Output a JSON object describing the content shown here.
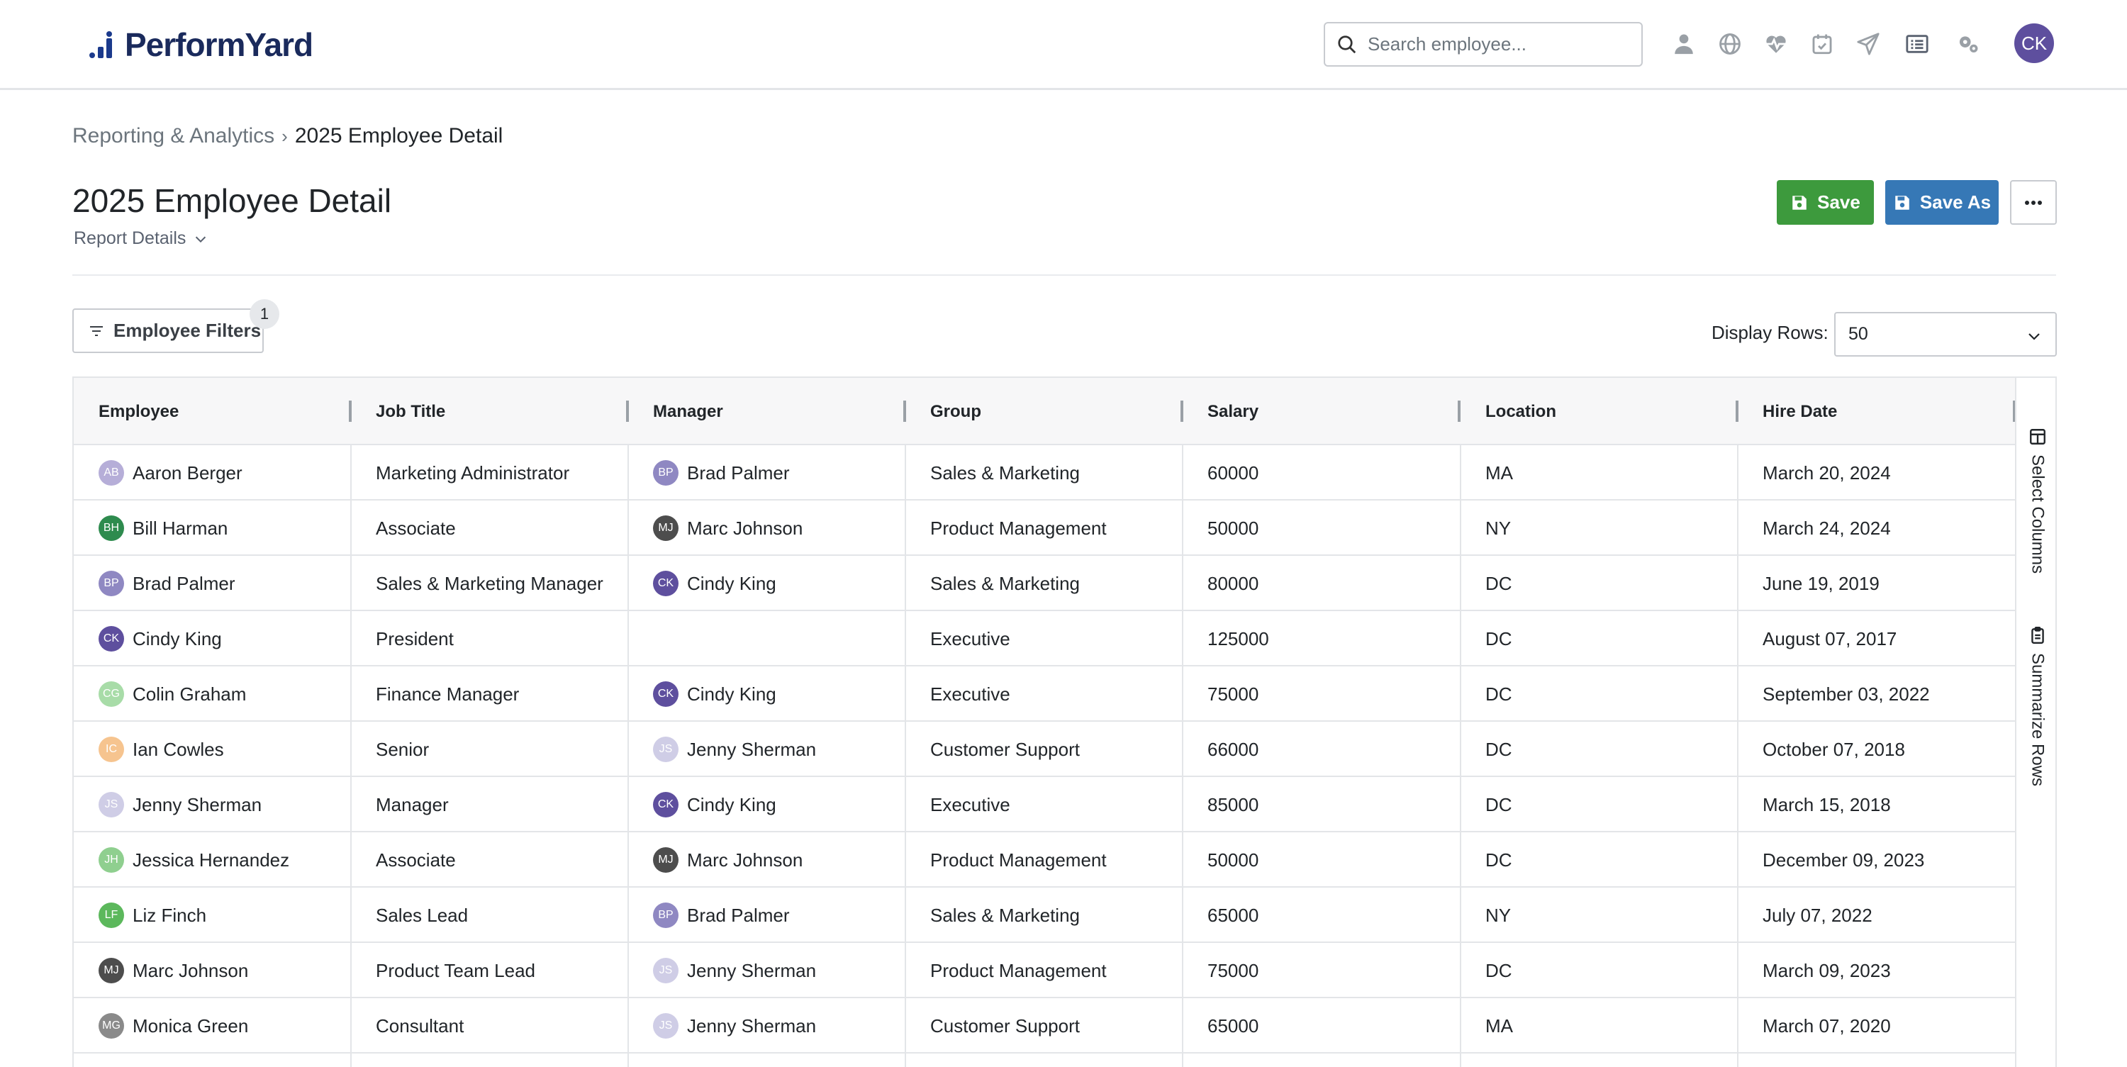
{
  "app": {
    "name": "PerformYard",
    "search_placeholder": "Search employee...",
    "user_initials": "CK",
    "nav_icons": [
      "person-icon",
      "globe-icon",
      "heartbeat-icon",
      "calendar-check-icon",
      "paper-plane-icon",
      "list-icon",
      "gears-icon"
    ]
  },
  "breadcrumb": {
    "parent": "Reporting & Analytics",
    "current": "2025 Employee Detail"
  },
  "page": {
    "title": "2025 Employee Detail",
    "report_details": "Report Details",
    "save_label": "Save",
    "save_as_label": "Save As",
    "more_label": "..."
  },
  "filters": {
    "label": "Employee Filters",
    "count": "1",
    "display_rows_label": "Display Rows:",
    "display_rows_value": "50"
  },
  "table": {
    "columns": [
      "Employee",
      "Job Title",
      "Manager",
      "Group",
      "Salary",
      "Location",
      "Hire Date"
    ],
    "rows": [
      {
        "employee": "Aaron Berger",
        "emp_initials": "AB",
        "emp_color": "#b6aed8",
        "job_title": "Marketing Administrator",
        "manager": "Brad Palmer",
        "mgr_initials": "BP",
        "mgr_color": "#8f88c2",
        "group": "Sales & Marketing",
        "salary": "60000",
        "location": "MA",
        "hire_date": "March 20, 2024"
      },
      {
        "employee": "Bill Harman",
        "emp_initials": "BH",
        "emp_color": "#2e8b4e",
        "job_title": "Associate",
        "manager": "Marc Johnson",
        "mgr_initials": "MJ",
        "mgr_color": "#4d4d4d",
        "group": "Product Management",
        "salary": "50000",
        "location": "NY",
        "hire_date": "March 24, 2024"
      },
      {
        "employee": "Brad Palmer",
        "emp_initials": "BP",
        "emp_color": "#8f88c2",
        "job_title": "Sales & Marketing Manager",
        "manager": "Cindy King",
        "mgr_initials": "CK",
        "mgr_color": "#5e4f9e",
        "group": "Sales & Marketing",
        "salary": "80000",
        "location": "DC",
        "hire_date": "June 19, 2019"
      },
      {
        "employee": "Cindy King",
        "emp_initials": "CK",
        "emp_color": "#5e4f9e",
        "job_title": "President",
        "manager": "",
        "mgr_initials": "",
        "mgr_color": "",
        "group": "Executive",
        "salary": "125000",
        "location": "DC",
        "hire_date": "August 07, 2017"
      },
      {
        "employee": "Colin Graham",
        "emp_initials": "CG",
        "emp_color": "#a8dca8",
        "job_title": "Finance Manager",
        "manager": "Cindy King",
        "mgr_initials": "CK",
        "mgr_color": "#5e4f9e",
        "group": "Executive",
        "salary": "75000",
        "location": "DC",
        "hire_date": "September 03, 2022"
      },
      {
        "employee": "Ian Cowles",
        "emp_initials": "IC",
        "emp_color": "#f6c48f",
        "job_title": "Senior",
        "manager": "Jenny Sherman",
        "mgr_initials": "JS",
        "mgr_color": "#cfcde6",
        "group": "Customer Support",
        "salary": "66000",
        "location": "DC",
        "hire_date": "October 07, 2018"
      },
      {
        "employee": "Jenny Sherman",
        "emp_initials": "JS",
        "emp_color": "#cfcde6",
        "job_title": "Manager",
        "manager": "Cindy King",
        "mgr_initials": "CK",
        "mgr_color": "#5e4f9e",
        "group": "Executive",
        "salary": "85000",
        "location": "DC",
        "hire_date": "March 15, 2018"
      },
      {
        "employee": "Jessica Hernandez",
        "emp_initials": "JH",
        "emp_color": "#8fcf8f",
        "job_title": "Associate",
        "manager": "Marc Johnson",
        "mgr_initials": "MJ",
        "mgr_color": "#4d4d4d",
        "group": "Product Management",
        "salary": "50000",
        "location": "DC",
        "hire_date": "December 09, 2023"
      },
      {
        "employee": "Liz Finch",
        "emp_initials": "LF",
        "emp_color": "#5cb85c",
        "job_title": "Sales Lead",
        "manager": "Brad Palmer",
        "mgr_initials": "BP",
        "mgr_color": "#8f88c2",
        "group": "Sales & Marketing",
        "salary": "65000",
        "location": "NY",
        "hire_date": "July 07, 2022"
      },
      {
        "employee": "Marc Johnson",
        "emp_initials": "MJ",
        "emp_color": "#4d4d4d",
        "job_title": "Product Team Lead",
        "manager": "Jenny Sherman",
        "mgr_initials": "JS",
        "mgr_color": "#cfcde6",
        "group": "Product Management",
        "salary": "75000",
        "location": "DC",
        "hire_date": "March 09, 2023"
      },
      {
        "employee": "Monica Green",
        "emp_initials": "MG",
        "emp_color": "#8a8a8a",
        "job_title": "Consultant",
        "manager": "Jenny Sherman",
        "mgr_initials": "JS",
        "mgr_color": "#cfcde6",
        "group": "Customer Support",
        "salary": "65000",
        "location": "MA",
        "hire_date": "March 07, 2020"
      }
    ]
  },
  "side_panel": {
    "select_columns": "Select Columns",
    "summarize_rows": "Summarize Rows"
  },
  "colors": {
    "save": "#3d9a3d",
    "save_as": "#3678b6",
    "brand_navy": "#1a2a5c",
    "avatar": "#5e4f9e"
  }
}
